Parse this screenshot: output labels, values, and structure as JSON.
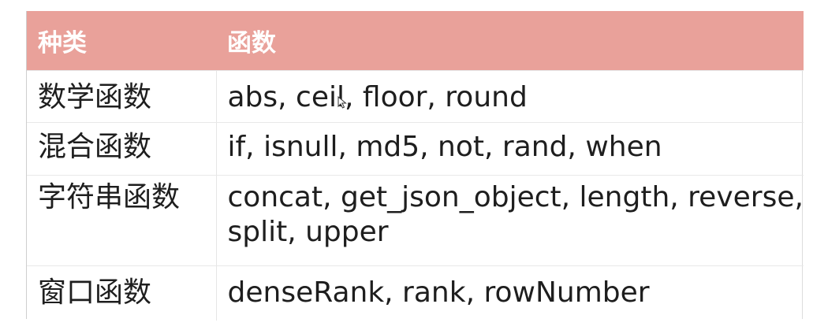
{
  "header": {
    "col1": "种类",
    "col2": "函数"
  },
  "rows": [
    {
      "category": "数学函数",
      "functions": "abs, ceil, floor, round"
    },
    {
      "category": "混合函数",
      "functions": "if, isnull, md5, not, rand, when"
    },
    {
      "category": "字符串函数",
      "functions": "concat, get_json_object, length, reverse, split, upper"
    },
    {
      "category": "窗口函数",
      "functions": "denseRank, rank, rowNumber"
    }
  ],
  "colors": {
    "header_bg": "#e9a19a",
    "header_text": "#ffffff",
    "body_text": "#1e1e1e"
  },
  "icons": {
    "cursor": "mouse-pointer-icon"
  }
}
